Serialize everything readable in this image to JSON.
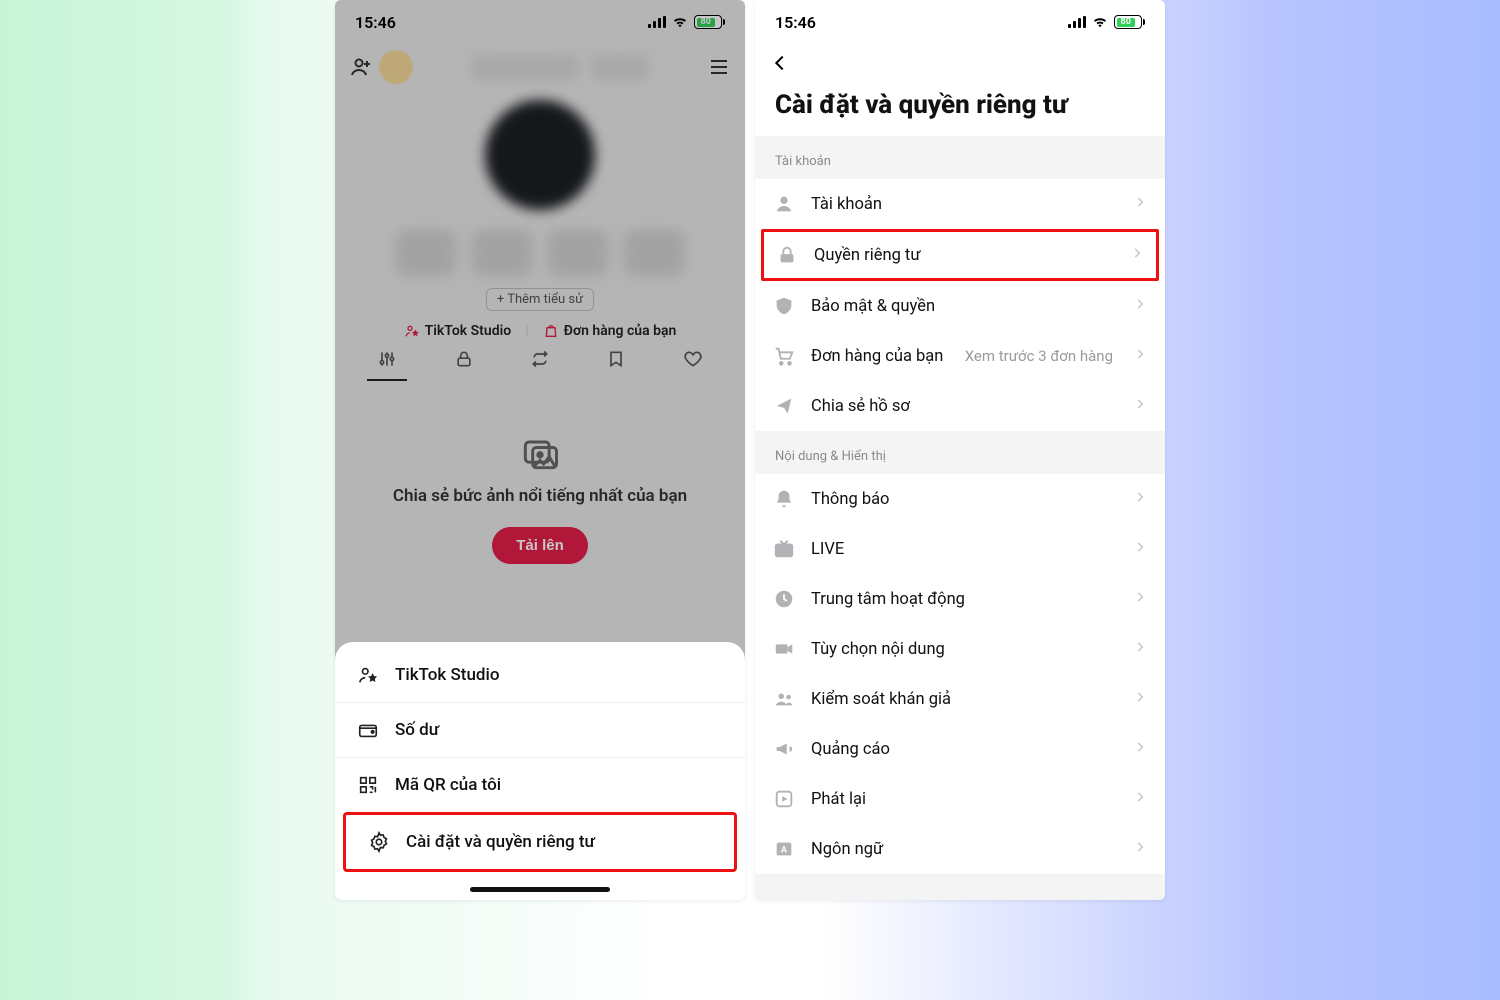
{
  "status": {
    "time": "15:46",
    "battery": "80"
  },
  "profile": {
    "bio_chip": "+ Thêm tiểu sử",
    "studio": "TikTok Studio",
    "orders": "Đơn hàng của bạn",
    "empty_title": "Chia sẻ bức ảnh nổi tiếng nhất của bạn",
    "upload": "Tải lên"
  },
  "sheet": {
    "items": [
      "TikTok Studio",
      "Số dư",
      "Mã QR của tôi",
      "Cài đặt và quyền riêng tư"
    ]
  },
  "settings": {
    "title": "Cài đặt và quyền riêng tư",
    "sections": {
      "account_label": "Tài khoản",
      "content_label": "Nội dung & Hiển thị"
    },
    "rows": {
      "account": "Tài khoản",
      "privacy": "Quyền riêng tư",
      "security": "Bảo mật & quyền",
      "orders": "Đơn hàng của bạn",
      "orders_sub": "Xem trước 3 đơn hàng",
      "share_profile": "Chia sẻ hồ sơ",
      "notifications": "Thông báo",
      "live": "LIVE",
      "activity": "Trung tâm hoạt động",
      "content_pref": "Tùy chọn nội dung",
      "audience": "Kiểm soát khán giả",
      "ads": "Quảng cáo",
      "playback": "Phát lại",
      "language": "Ngôn ngữ"
    }
  }
}
